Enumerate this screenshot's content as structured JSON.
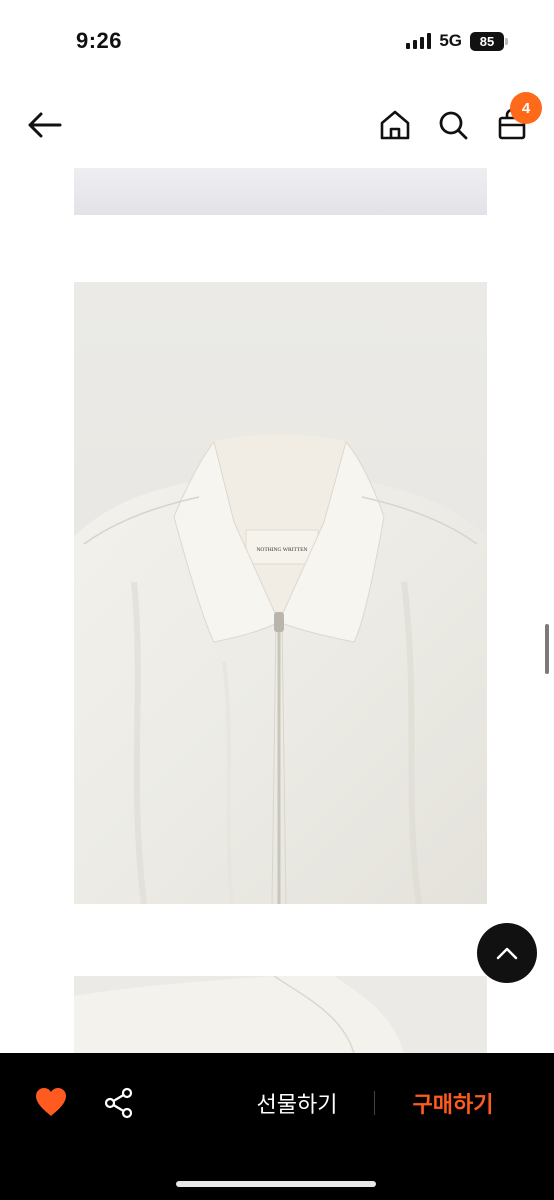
{
  "status_bar": {
    "time": "9:26",
    "network": "5G",
    "battery": "85"
  },
  "nav": {
    "back_icon": "arrow-left-icon",
    "home_icon": "home-icon",
    "search_icon": "search-icon",
    "bag_icon": "shopping-bag-icon",
    "cart_count": "4"
  },
  "product_image": {
    "label_text": "NOTHING WRITTEN"
  },
  "bottom_bar": {
    "like_icon": "heart-icon",
    "share_icon": "share-icon",
    "gift_label": "선물하기",
    "buy_label": "구매하기"
  },
  "colors": {
    "accent": "#ff6a1a",
    "buy": "#ff5a1f",
    "bar_bg": "#000000"
  }
}
